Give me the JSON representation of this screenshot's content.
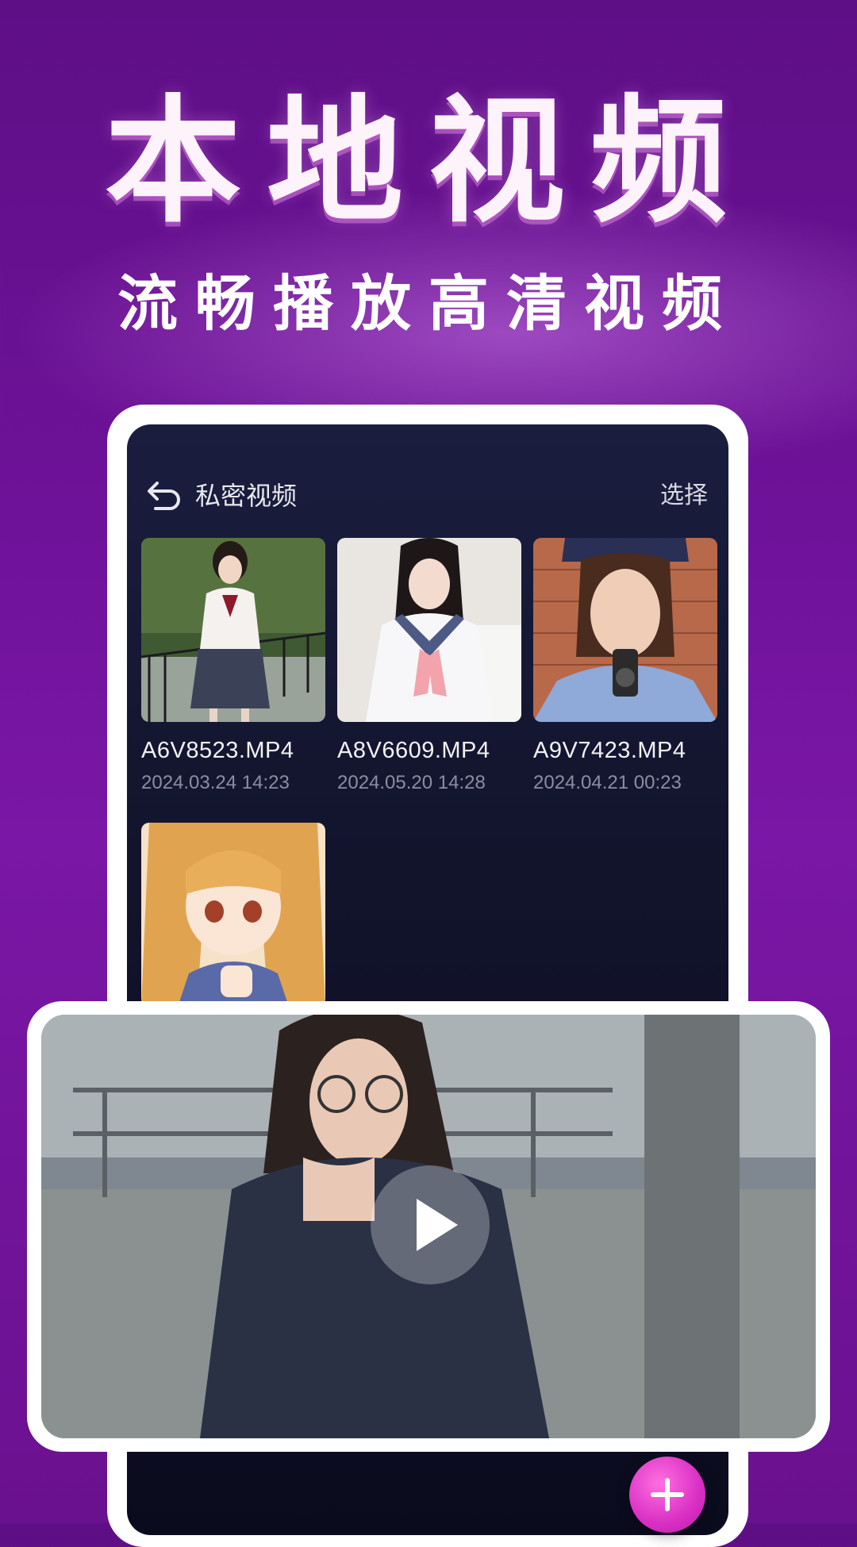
{
  "promo": {
    "title": "本地视频",
    "subtitle": "流畅播放高清视频"
  },
  "screen": {
    "header": {
      "title": "私密视频",
      "action_label": "选择",
      "back_icon": "back-arrow-icon"
    },
    "videos": [
      {
        "filename": "A6V8523.MP4",
        "date": "2024.03.24  14:23"
      },
      {
        "filename": "A8V6609.MP4",
        "date": "2024.05.20 14:28"
      },
      {
        "filename": "A9V7423.MP4",
        "date": "2024.04.21 00:23"
      },
      {
        "filename": "",
        "date": ""
      }
    ],
    "player": {
      "play_icon": "play-icon"
    },
    "fab_icon": "plus-icon"
  },
  "colors": {
    "background": "#6f129a",
    "screen_background": "#12142c",
    "fab": "#d92fc4"
  }
}
